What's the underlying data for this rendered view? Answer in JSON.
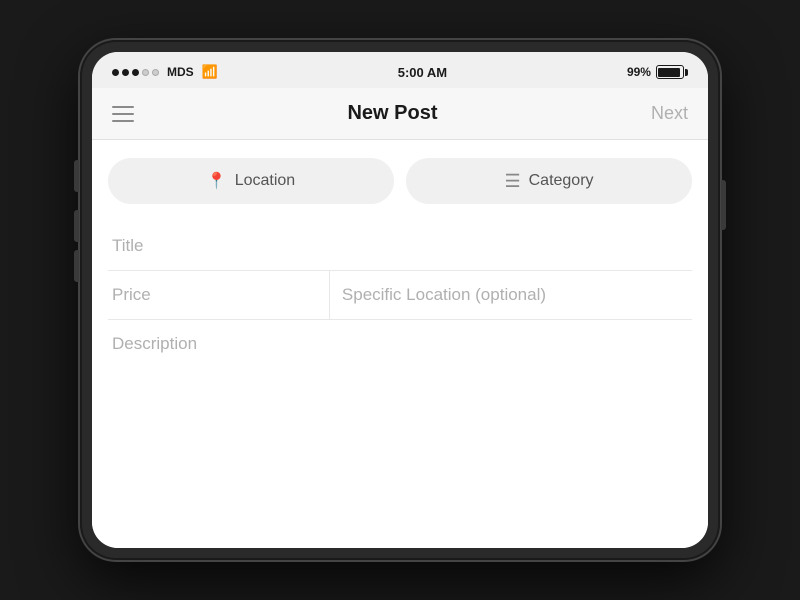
{
  "status_bar": {
    "carrier": "MDS",
    "time": "5:00 AM",
    "battery_percent": "99%",
    "signal_dots": [
      true,
      true,
      true,
      false,
      false
    ]
  },
  "nav": {
    "title": "New Post",
    "next_label": "Next",
    "menu_icon": "hamburger"
  },
  "pills": [
    {
      "label": "Location",
      "icon": "📍"
    },
    {
      "label": "Category",
      "icon": "≡"
    }
  ],
  "form": {
    "title_placeholder": "Title",
    "price_placeholder": "Price",
    "specific_location_placeholder": "Specific Location (optional)",
    "description_placeholder": "Description"
  },
  "colors": {
    "background": "#1a1a1a",
    "screen_bg": "#ffffff",
    "status_bar_bg": "#f0f0f0",
    "nav_bg": "#f7f7f7",
    "pill_bg": "#f0f0f0",
    "placeholder_color": "#b0b0b0",
    "text_primary": "#1a1a1a",
    "text_muted": "#8a8a8a",
    "border_color": "#e8e8e8"
  }
}
